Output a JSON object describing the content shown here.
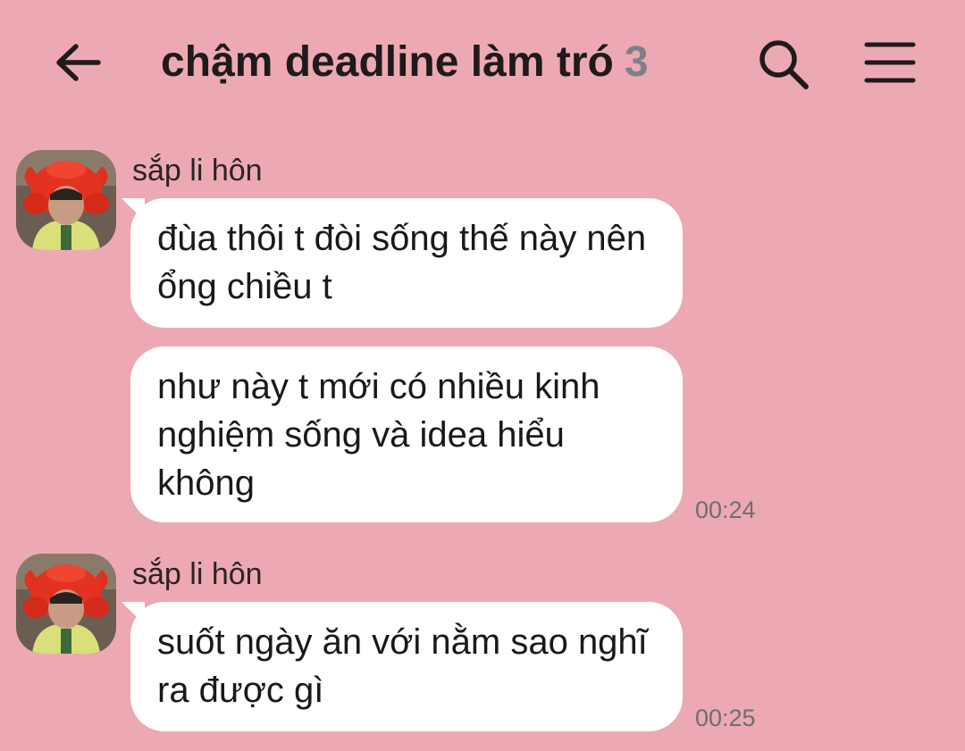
{
  "header": {
    "title": "chậm deadline làm tró",
    "member_count": "3",
    "back_icon": "arrow-left-icon",
    "search_icon": "search-icon",
    "menu_icon": "hamburger-menu-icon"
  },
  "colors": {
    "background": "#eda9b3",
    "bubble": "#ffffff",
    "count": "#7c8187",
    "time": "#6f6d70"
  },
  "messages": [
    {
      "sender": "sắp li hôn",
      "avatar": "crab-hat-avatar",
      "bubbles": [
        {
          "text": "đùa thôi t đòi sống thế này nên ổng chiều t",
          "time": ""
        },
        {
          "text": "như này t mới có nhiều kinh nghiệm sống và idea hiểu không",
          "time": "00:24"
        }
      ]
    },
    {
      "sender": "sắp li hôn",
      "avatar": "crab-hat-avatar",
      "bubbles": [
        {
          "text": "suốt ngày ăn với nằm sao nghĩ ra được gì",
          "time": "00:25"
        }
      ]
    }
  ]
}
